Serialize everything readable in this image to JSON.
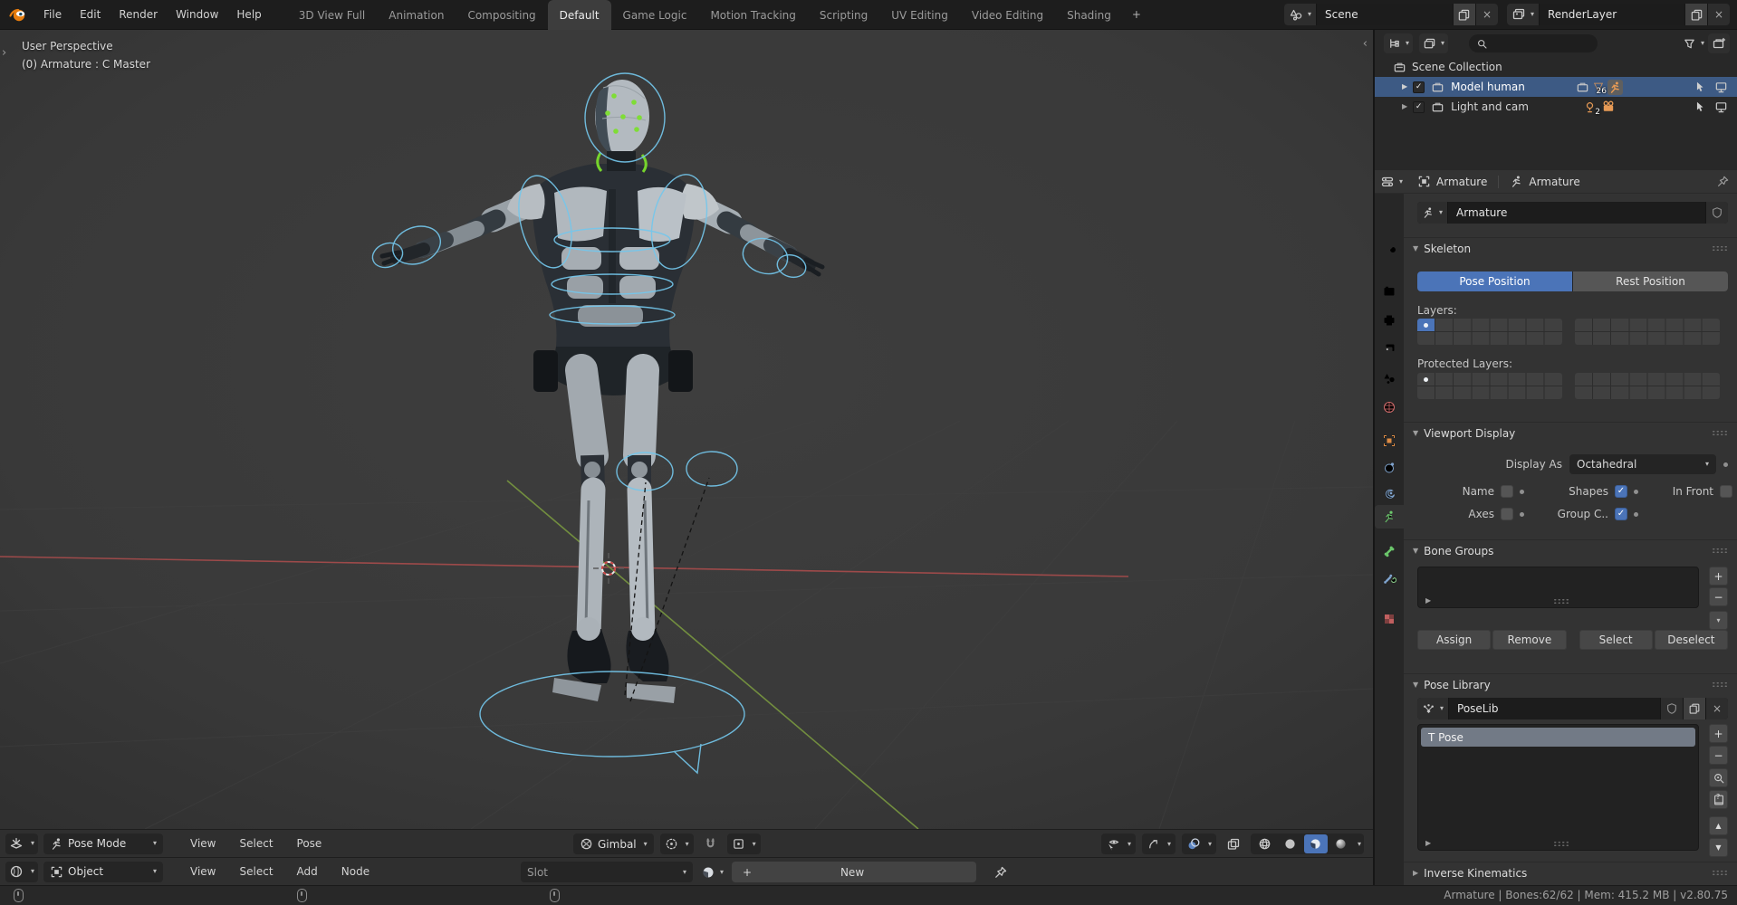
{
  "glyphs": {
    "chevron_down": "▾",
    "chevron_right": "▸",
    "tri_down": "▼",
    "tri_right": "▶",
    "tri_up_small": "▲",
    "tri_down_small": "▼",
    "plus": "+",
    "minus": "−",
    "close": "×",
    "check": "✓",
    "mesh_tri": "▽",
    "question": "?",
    "panel_right": "›",
    "panel_left": "‹"
  },
  "colors": {
    "accent_blue": "#4b74b8",
    "selection_blue": "#3d5a84",
    "outliner_orange": "#e79a55",
    "bone_widget_blue": "#74c7ec",
    "axis_x_red": "#9d4a4a",
    "axis_y_green": "#728e3f",
    "armature_green": "#6bc76b"
  },
  "topbar": {
    "menus": {
      "file": "File",
      "edit": "Edit",
      "render": "Render",
      "window": "Window",
      "help": "Help"
    },
    "workspaces": [
      "3D View Full",
      "Animation",
      "Compositing",
      "Default",
      "Game Logic",
      "Motion Tracking",
      "Scripting",
      "UV Editing",
      "Video Editing",
      "Shading"
    ],
    "active_workspace": "Default",
    "add_workspace": "+",
    "scene": "Scene",
    "render_layer": "RenderLayer"
  },
  "viewport": {
    "perspective_label": "User Perspective",
    "active_label": "(0) Armature : C Master",
    "mode": "Pose Mode",
    "menus": {
      "view": "View",
      "select": "Select",
      "pose": "Pose"
    },
    "orientation": "Gimbal"
  },
  "shader_editor": {
    "shader_type": "Object",
    "menus": {
      "view": "View",
      "select": "Select",
      "add": "Add",
      "node": "Node"
    },
    "slot": "Slot",
    "new_button": "New"
  },
  "outliner": {
    "scene_collection": "Scene Collection",
    "rows": [
      {
        "label": "Model human",
        "mesh_count": "26",
        "selected": true
      },
      {
        "label": "Light and cam",
        "light_count": "2",
        "selected": false
      }
    ]
  },
  "properties": {
    "breadcrumb": {
      "object": "Armature",
      "data": "Armature"
    },
    "name_field": "Armature",
    "skeleton": {
      "title": "Skeleton",
      "pose_position": "Pose Position",
      "rest_position": "Rest Position",
      "layers_label": "Layers:",
      "protected_layers_label": "Protected Layers:"
    },
    "viewport_display": {
      "title": "Viewport Display",
      "display_as_label": "Display As",
      "display_as_value": "Octahedral",
      "name_label": "Name",
      "shapes_label": "Shapes",
      "in_front_label": "In Front",
      "axes_label": "Axes",
      "group_colors_label": "Group C..",
      "name_checked": false,
      "shapes_checked": true,
      "in_front_checked": false,
      "axes_checked": false,
      "group_colors_checked": true
    },
    "bone_groups": {
      "title": "Bone Groups",
      "assign": "Assign",
      "remove": "Remove",
      "select": "Select",
      "deselect": "Deselect"
    },
    "pose_library": {
      "title": "Pose Library",
      "datablock": "PoseLib",
      "pose_items": [
        "T Pose"
      ]
    },
    "inverse_kinematics": {
      "title": "Inverse Kinematics"
    }
  },
  "statusbar": {
    "info": "Armature | Bones:62/62  | Mem: 415.2 MB | v2.80.75"
  }
}
